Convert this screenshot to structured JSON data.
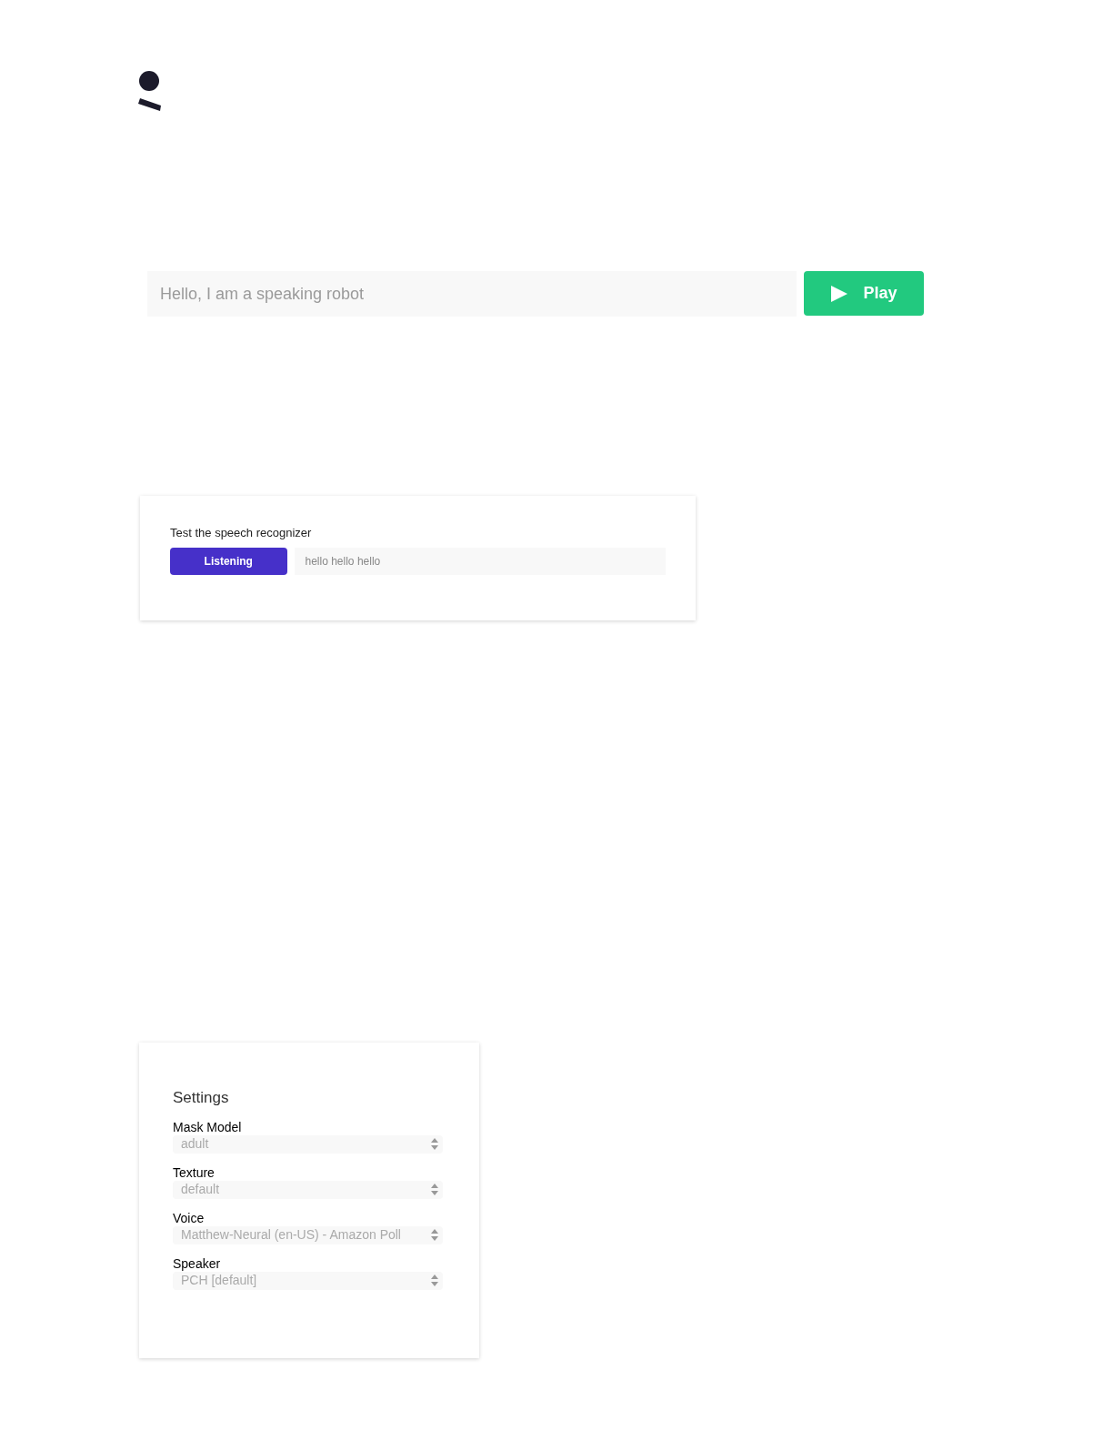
{
  "speak": {
    "placeholder": "Hello, I am a speaking robot",
    "button": "Play"
  },
  "recognizer": {
    "title": "Test the speech recognizer",
    "button": "Listening",
    "result": "hello hello hello"
  },
  "settings": {
    "title": "Settings",
    "fields": [
      {
        "label": "Mask Model",
        "value": "adult"
      },
      {
        "label": "Texture",
        "value": "default"
      },
      {
        "label": "Voice",
        "value": "Matthew-Neural (en-US) - Amazon Poll"
      },
      {
        "label": "Speaker",
        "value": "PCH [default]"
      }
    ]
  }
}
